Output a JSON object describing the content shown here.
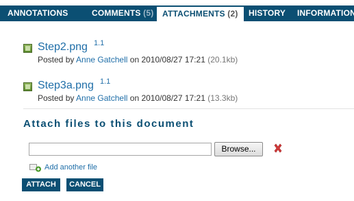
{
  "tabs": [
    {
      "label": "Annotations",
      "count": ""
    },
    {
      "label": "Comments",
      "count": "(5)"
    },
    {
      "label": "Attachments",
      "count": "(2)"
    },
    {
      "label": "History",
      "count": ""
    },
    {
      "label": "Information",
      "count": ""
    }
  ],
  "attachments": [
    {
      "filename": "Step2.png",
      "version": "1.1",
      "posted_by_prefix": "Posted by",
      "author": "Anne Gatchell",
      "on_text": "on 2010/08/27 17:21",
      "size": "(20.1kb)"
    },
    {
      "filename": "Step3a.png",
      "version": "1.1",
      "posted_by_prefix": "Posted by",
      "author": "Anne Gatchell",
      "on_text": "on 2010/08/27 17:21",
      "size": "(13.3kb)"
    }
  ],
  "attach_form": {
    "title": "Attach files to this document",
    "file_value": "",
    "browse_label": "Browse...",
    "add_another_label": "Add another file",
    "attach_button": "Attach",
    "cancel_button": "Cancel"
  },
  "icons": {
    "file": "image-file-icon",
    "remove": "remove-x-icon",
    "add": "add-file-icon"
  },
  "colors": {
    "tab_bar": "#0b4f73",
    "link": "#1f6ea8",
    "remove_x": "#d23b3b"
  }
}
